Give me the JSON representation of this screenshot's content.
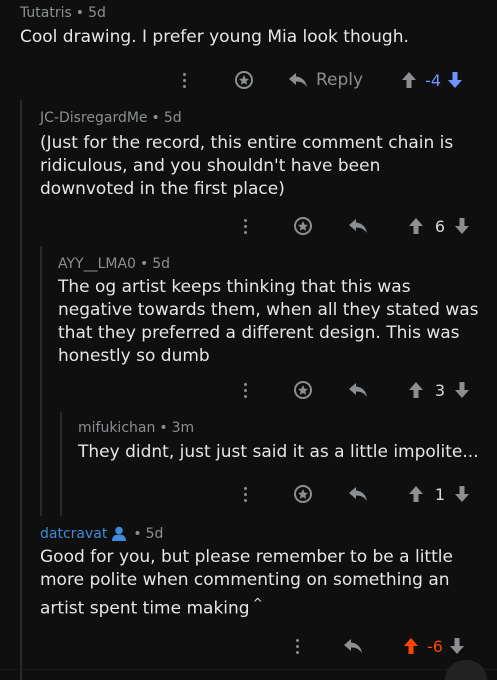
{
  "comments": [
    {
      "user": "Tutatris",
      "time": "5d",
      "text": "Cool drawing. I prefer young Mia look though.",
      "reply_label": "Reply",
      "score": "-4",
      "vote_state": "down"
    },
    {
      "user": "JC-DisregardMe",
      "time": "5d",
      "text": "(Just for the record, this entire comment chain is ridiculous, and you shouldn't have been downvoted in the first place)",
      "score": "6",
      "vote_state": "none"
    },
    {
      "user": "AYY__LMA0",
      "time": "5d",
      "text": "The og artist keeps thinking that this was negative towards them, when all they stated was that they preferred a different design. This was honestly so dumb",
      "score": "3",
      "vote_state": "none"
    },
    {
      "user": "mifukichan",
      "time": "3m",
      "text": "They didnt, just just said it as a little impolite...",
      "score": "1",
      "vote_state": "none"
    },
    {
      "user": "datcravat",
      "time": "5d",
      "text": "Good for you, but please remember to be a little more polite when commenting on something an artist spent time making",
      "caret": "^",
      "score": "-6",
      "vote_state": "up"
    }
  ],
  "colors": {
    "background": "#0f0f0f",
    "text": "#e6e6e6",
    "meta": "#8b8f92",
    "downvote": "#7193ff",
    "upvote": "#ff4500",
    "op_user": "#3d8bd9"
  },
  "icons": [
    "more-icon",
    "award-icon",
    "reply-icon",
    "upvote-icon",
    "downvote-icon",
    "user-icon"
  ]
}
